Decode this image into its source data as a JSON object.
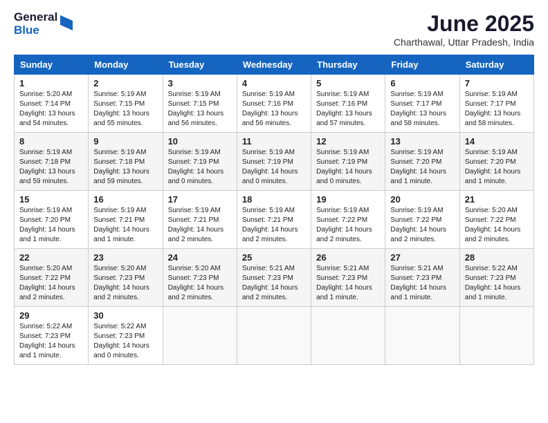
{
  "logo": {
    "general": "General",
    "blue": "Blue"
  },
  "title": "June 2025",
  "subtitle": "Charthawal, Uttar Pradesh, India",
  "days": [
    "Sunday",
    "Monday",
    "Tuesday",
    "Wednesday",
    "Thursday",
    "Friday",
    "Saturday"
  ],
  "weeks": [
    [
      {
        "day": "1",
        "sunrise": "5:20 AM",
        "sunset": "7:14 PM",
        "daylight": "13 hours and 54 minutes."
      },
      {
        "day": "2",
        "sunrise": "5:19 AM",
        "sunset": "7:15 PM",
        "daylight": "13 hours and 55 minutes."
      },
      {
        "day": "3",
        "sunrise": "5:19 AM",
        "sunset": "7:15 PM",
        "daylight": "13 hours and 56 minutes."
      },
      {
        "day": "4",
        "sunrise": "5:19 AM",
        "sunset": "7:16 PM",
        "daylight": "13 hours and 56 minutes."
      },
      {
        "day": "5",
        "sunrise": "5:19 AM",
        "sunset": "7:16 PM",
        "daylight": "13 hours and 57 minutes."
      },
      {
        "day": "6",
        "sunrise": "5:19 AM",
        "sunset": "7:17 PM",
        "daylight": "13 hours and 58 minutes."
      },
      {
        "day": "7",
        "sunrise": "5:19 AM",
        "sunset": "7:17 PM",
        "daylight": "13 hours and 58 minutes."
      }
    ],
    [
      {
        "day": "8",
        "sunrise": "5:19 AM",
        "sunset": "7:18 PM",
        "daylight": "13 hours and 59 minutes."
      },
      {
        "day": "9",
        "sunrise": "5:19 AM",
        "sunset": "7:18 PM",
        "daylight": "13 hours and 59 minutes."
      },
      {
        "day": "10",
        "sunrise": "5:19 AM",
        "sunset": "7:19 PM",
        "daylight": "14 hours and 0 minutes."
      },
      {
        "day": "11",
        "sunrise": "5:19 AM",
        "sunset": "7:19 PM",
        "daylight": "14 hours and 0 minutes."
      },
      {
        "day": "12",
        "sunrise": "5:19 AM",
        "sunset": "7:19 PM",
        "daylight": "14 hours and 0 minutes."
      },
      {
        "day": "13",
        "sunrise": "5:19 AM",
        "sunset": "7:20 PM",
        "daylight": "14 hours and 1 minute."
      },
      {
        "day": "14",
        "sunrise": "5:19 AM",
        "sunset": "7:20 PM",
        "daylight": "14 hours and 1 minute."
      }
    ],
    [
      {
        "day": "15",
        "sunrise": "5:19 AM",
        "sunset": "7:20 PM",
        "daylight": "14 hours and 1 minute."
      },
      {
        "day": "16",
        "sunrise": "5:19 AM",
        "sunset": "7:21 PM",
        "daylight": "14 hours and 1 minute."
      },
      {
        "day": "17",
        "sunrise": "5:19 AM",
        "sunset": "7:21 PM",
        "daylight": "14 hours and 2 minutes."
      },
      {
        "day": "18",
        "sunrise": "5:19 AM",
        "sunset": "7:21 PM",
        "daylight": "14 hours and 2 minutes."
      },
      {
        "day": "19",
        "sunrise": "5:19 AM",
        "sunset": "7:22 PM",
        "daylight": "14 hours and 2 minutes."
      },
      {
        "day": "20",
        "sunrise": "5:19 AM",
        "sunset": "7:22 PM",
        "daylight": "14 hours and 2 minutes."
      },
      {
        "day": "21",
        "sunrise": "5:20 AM",
        "sunset": "7:22 PM",
        "daylight": "14 hours and 2 minutes."
      }
    ],
    [
      {
        "day": "22",
        "sunrise": "5:20 AM",
        "sunset": "7:22 PM",
        "daylight": "14 hours and 2 minutes."
      },
      {
        "day": "23",
        "sunrise": "5:20 AM",
        "sunset": "7:23 PM",
        "daylight": "14 hours and 2 minutes."
      },
      {
        "day": "24",
        "sunrise": "5:20 AM",
        "sunset": "7:23 PM",
        "daylight": "14 hours and 2 minutes."
      },
      {
        "day": "25",
        "sunrise": "5:21 AM",
        "sunset": "7:23 PM",
        "daylight": "14 hours and 2 minutes."
      },
      {
        "day": "26",
        "sunrise": "5:21 AM",
        "sunset": "7:23 PM",
        "daylight": "14 hours and 1 minute."
      },
      {
        "day": "27",
        "sunrise": "5:21 AM",
        "sunset": "7:23 PM",
        "daylight": "14 hours and 1 minute."
      },
      {
        "day": "28",
        "sunrise": "5:22 AM",
        "sunset": "7:23 PM",
        "daylight": "14 hours and 1 minute."
      }
    ],
    [
      {
        "day": "29",
        "sunrise": "5:22 AM",
        "sunset": "7:23 PM",
        "daylight": "14 hours and 1 minute."
      },
      {
        "day": "30",
        "sunrise": "5:22 AM",
        "sunset": "7:23 PM",
        "daylight": "14 hours and 0 minutes."
      },
      null,
      null,
      null,
      null,
      null
    ]
  ],
  "labels": {
    "sunrise": "Sunrise:",
    "sunset": "Sunset:",
    "daylight": "Daylight:"
  }
}
